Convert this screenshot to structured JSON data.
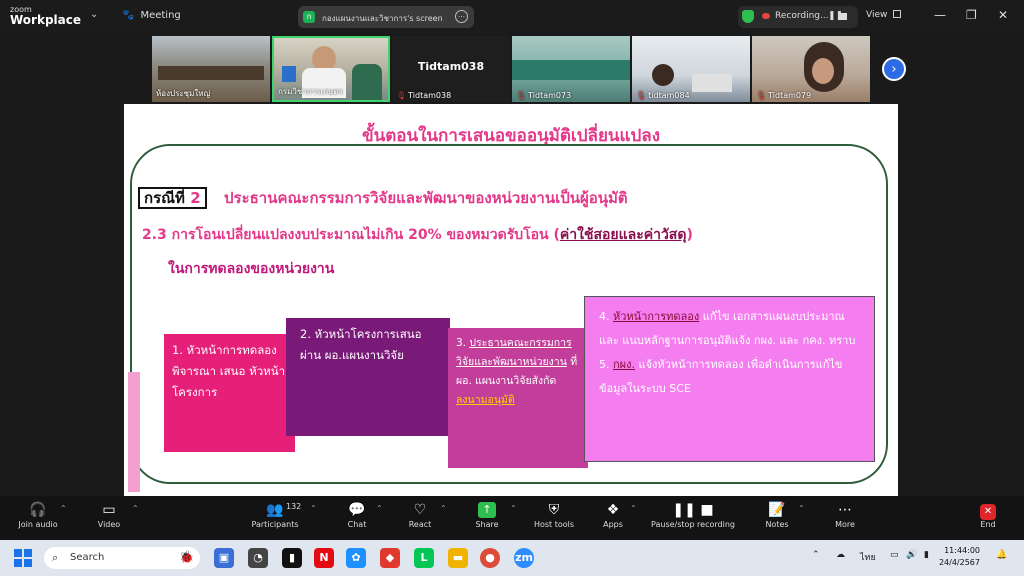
{
  "titlebar": {
    "logo_top": "zoom",
    "logo_bottom": "Workplace",
    "meeting_label": "Meeting",
    "share_label": "กองแผนงานและวิชาการ's screen",
    "share_initial": "ก",
    "recording_label": "Recording...",
    "view_label": "View"
  },
  "thumbnails": [
    {
      "name": "ห้องประชุมใหญ่",
      "type": "video"
    },
    {
      "name": "กรมวิชาการเกษตร",
      "type": "video",
      "active": true
    },
    {
      "name": "Tidtam038",
      "type": "name"
    },
    {
      "name": "Tidtam073",
      "type": "video"
    },
    {
      "name": "tidtam084",
      "type": "video"
    },
    {
      "name": "Tidtam079",
      "type": "video"
    }
  ],
  "slide": {
    "title": "ขั้นตอนในการเสนอขออนุมัติเปลี่ยนแปลง",
    "case_label": "กรณีที่",
    "case_num": "2",
    "case_text": "ประธานคณะกรรมการวิจัยและพัฒนาของหน่วยงานเป็นผู้อนุมัติ",
    "line_23": "2.3 การโอนเปลี่ยนแปลงงบประมาณไม่เกิน 20% ของหมวดรับโอน (",
    "line_23_ul": "ค่าใช้สอยและค่าวัสดุ",
    "line_23_end": ")",
    "line_23b": "ในการทดลองของหน่วยงาน",
    "step1": "1. หัวหน้าการทดลองพิจารณา เสนอ หัวหน้าโครงการ",
    "step2": "2. หัวหน้าโครงการเสนอ ผ่าน ผอ.แผนงานวิจัย",
    "step3_a": "3.",
    "step3_ul": "ประธานคณะกรรมการวิจัยและพัฒนาหน่วยงาน",
    "step3_b": "ที่ ผอ. แผนงานวิจัยสังกัด",
    "step3_y": "ลงนามอนุมัติ",
    "step4_a": "4.",
    "step4_ul": "หัวหน้าการทดลอง",
    "step4_b": "แก้ไข เอกสารแผนงบประมาณ และ แนบหลักฐานการอนุมัติแจ้ง กผง. และ กคง. ทราบ",
    "step5_a": "5.",
    "step5_ul": "กผง.",
    "step5_b": "แจ้งหัวหน้าการทดลอง เพื่อดำเนินการแก้ไขข้อมูลในระบบ SCE"
  },
  "toolbar": {
    "join_audio": "Join audio",
    "video": "Video",
    "participants": "Participants",
    "participants_count": "132",
    "chat": "Chat",
    "react": "React",
    "share": "Share",
    "host_tools": "Host tools",
    "apps": "Apps",
    "pause_stop": "Pause/stop recording",
    "notes": "Notes",
    "more": "More",
    "end": "End"
  },
  "taskbar": {
    "search_placeholder": "Search",
    "lang": "ไทย",
    "time": "11:44:00",
    "date": "24/4/2567"
  }
}
